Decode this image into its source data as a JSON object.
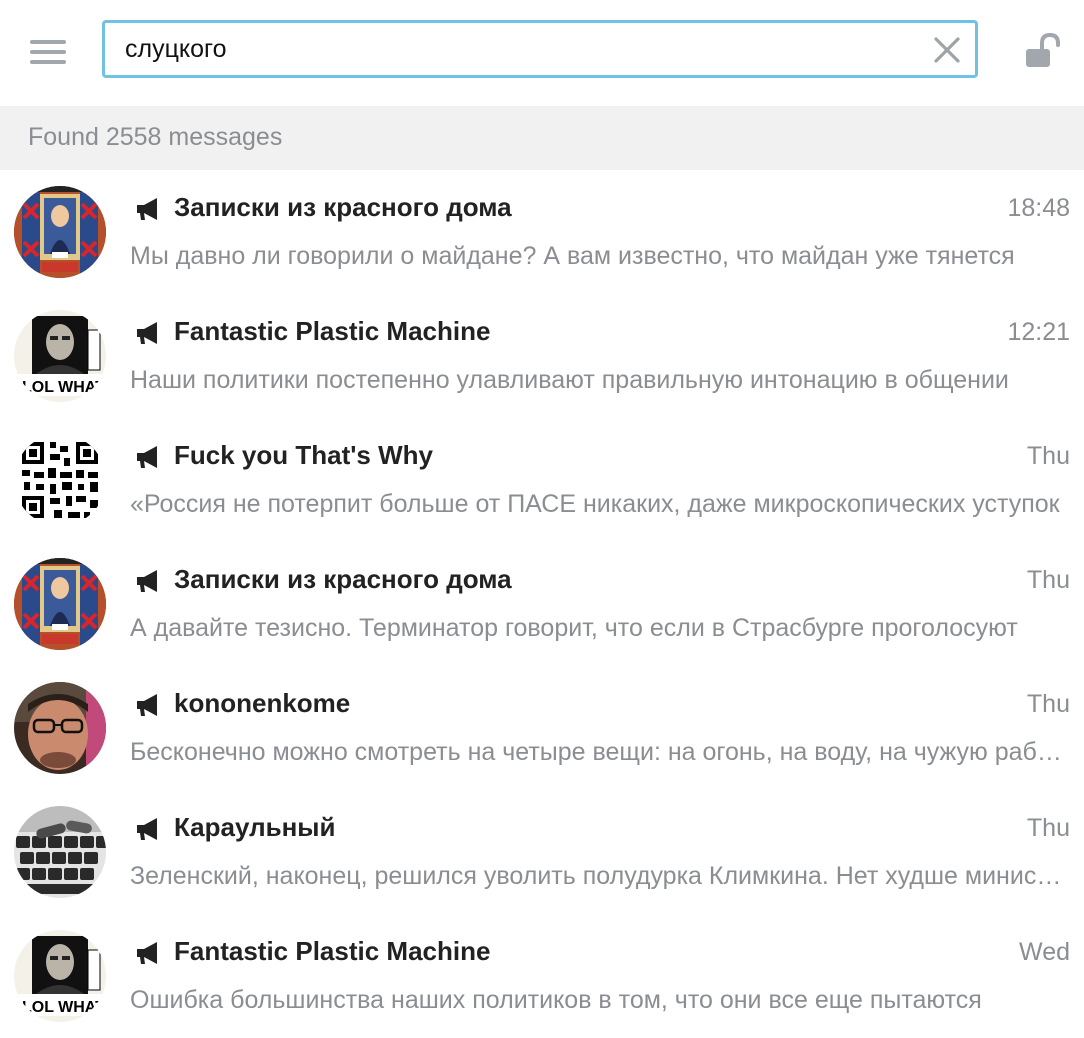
{
  "header": {
    "search_value": "слуцкого",
    "icons": {
      "menu": "hamburger-menu-icon",
      "clear": "close-icon",
      "lock": "unlocked-padlock-icon"
    },
    "accent_color": "#6fc2e6"
  },
  "results": {
    "label": "Found 2558 messages"
  },
  "messages": [
    {
      "chat": "Записки из красного дома",
      "time": "18:48",
      "snippet": "Мы давно ли говорили о майдане? А вам известно, что майдан уже тянется",
      "avatar": "painting-portrait-avatar"
    },
    {
      "chat": "Fantastic Plastic Machine",
      "time": "12:21",
      "snippet": "Наши политики постепенно улавливают правильную интонацию в общении",
      "avatar": "lol-what-photo-avatar"
    },
    {
      "chat": "Fuck you That's Why",
      "time": "Thu",
      "snippet": "«Россия не потерпит больше от ПАСЕ никаких, даже микроскопических уступок",
      "avatar": "qr-code-avatar"
    },
    {
      "chat": "Записки из красного дома",
      "time": "Thu",
      "snippet": "А давайте тезисно. Терминатор говорит, что если в Страсбурге проголосуют",
      "avatar": "painting-portrait-avatar"
    },
    {
      "chat": "kononenkome",
      "time": "Thu",
      "snippet": "Бесконечно можно смотреть на четыре вещи: на огонь, на воду, на чужую работу",
      "avatar": "man-with-glasses-avatar"
    },
    {
      "chat": "Караульный",
      "time": "Thu",
      "snippet": "Зеленский, наконец, решился уволить полудурка Климкина. Нет худше министра",
      "avatar": "keyboard-cartridges-avatar"
    },
    {
      "chat": "Fantastic Plastic Machine",
      "time": "Wed",
      "snippet": "Ошибка большинства наших политиков в том, что они все еще пытаются",
      "avatar": "lol-what-photo-avatar"
    }
  ],
  "channel_icon": "megaphone-icon"
}
